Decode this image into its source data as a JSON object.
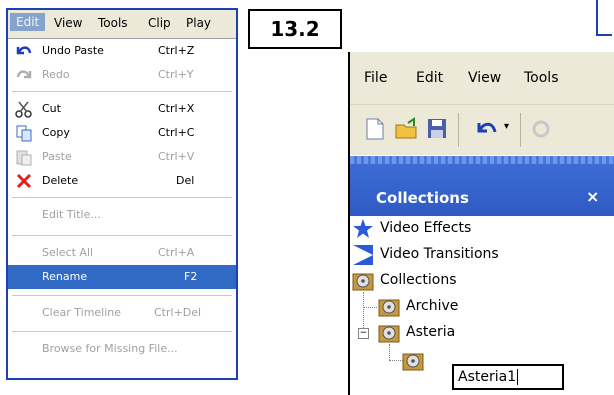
{
  "step_label": "13.2",
  "menubar": [
    "Edit",
    "View",
    "Tools",
    "Clip",
    "Play"
  ],
  "edit_menu": {
    "undo": {
      "label": "Undo Paste",
      "shortcut": "Ctrl+Z"
    },
    "redo": {
      "label": "Redo",
      "shortcut": "Ctrl+Y"
    },
    "cut": {
      "label": "Cut",
      "shortcut": "Ctrl+X"
    },
    "copy": {
      "label": "Copy",
      "shortcut": "Ctrl+C"
    },
    "paste": {
      "label": "Paste",
      "shortcut": "Ctrl+V"
    },
    "delete": {
      "label": "Delete",
      "shortcut": "Del"
    },
    "edit_title": {
      "label": "Edit Title..."
    },
    "select_all": {
      "label": "Select All",
      "shortcut": "Ctrl+A"
    },
    "rename": {
      "label": "Rename",
      "shortcut": "F2"
    },
    "clear_timeline": {
      "label": "Clear Timeline",
      "shortcut": "Ctrl+Del"
    },
    "browse": {
      "label": "Browse for Missing File..."
    }
  },
  "app_menubar": [
    "File",
    "Edit",
    "View",
    "Tools"
  ],
  "panel": {
    "title": "Collections",
    "close": "×"
  },
  "tree": {
    "video_effects": "Video Effects",
    "video_transitions": "Video Transitions",
    "collections": "Collections",
    "archive": "Archive",
    "asteria": "Asteria",
    "rename_value": "Asteria1"
  },
  "colors": {
    "highlight": "#316ac5",
    "frame": "#1d3fb8",
    "panel_header": "#2f5ac4"
  }
}
